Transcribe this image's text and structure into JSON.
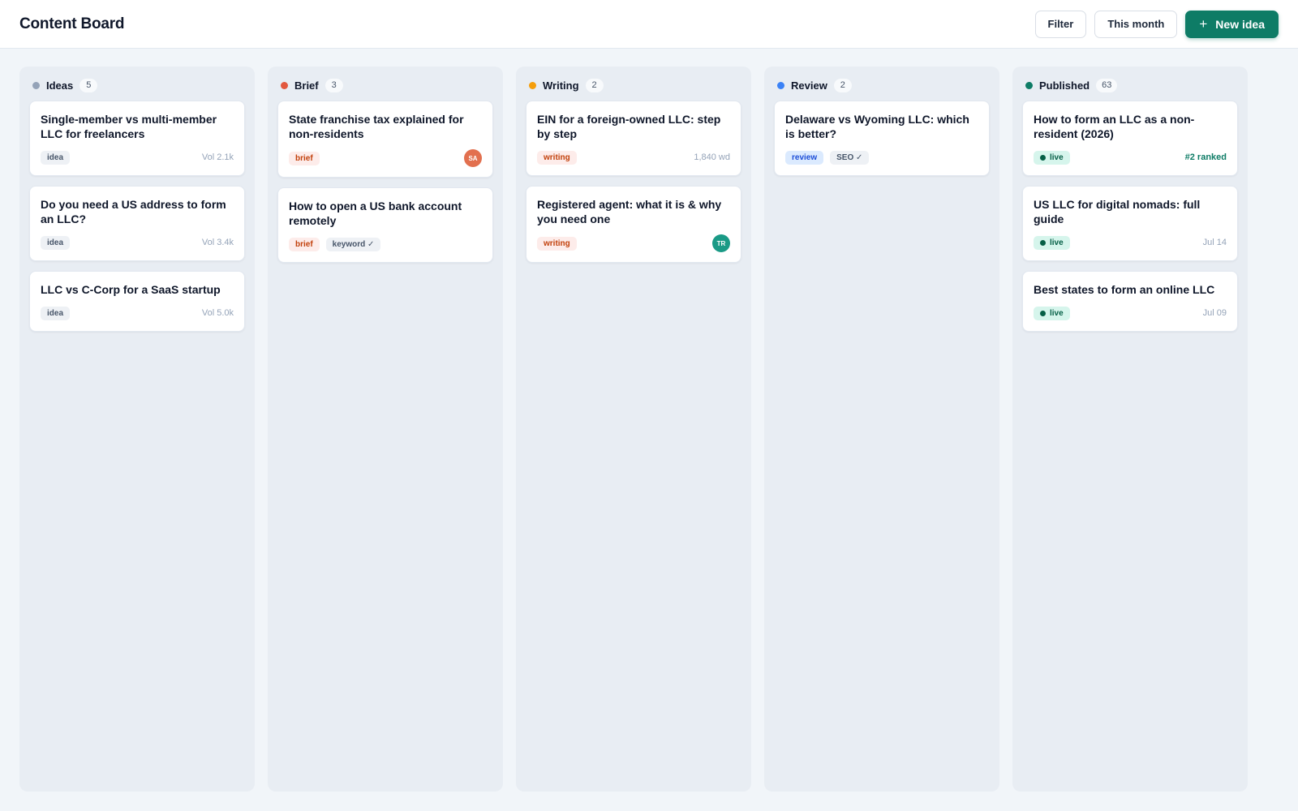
{
  "header": {
    "title": "Content Board",
    "filter_label": "Filter",
    "period_label": "This month",
    "new_label": "New idea",
    "new_icon": "plus-icon"
  },
  "colors": {
    "accent": "#0e7c66",
    "ideas": "#94a3b8",
    "brief": "#e2583e",
    "writing": "#f59e0b",
    "review": "#3b82f6",
    "published": "#0e7c66",
    "avatar_sa": "#e2704f",
    "avatar_tr": "#1a9a86"
  },
  "columns": [
    {
      "key": "ideas",
      "title": "Ideas",
      "count": "5",
      "cards": [
        {
          "title": "Single-member vs multi-member LLC for freelancers",
          "tag": "idea",
          "meta": "Vol 2.1k"
        },
        {
          "title": "Do you need a US address to form an LLC?",
          "tag": "idea",
          "meta": "Vol 3.4k"
        },
        {
          "title": "LLC vs C-Corp for a SaaS startup",
          "tag": "idea",
          "meta": "Vol 5.0k"
        }
      ]
    },
    {
      "key": "brief",
      "title": "Brief",
      "count": "3",
      "cards": [
        {
          "title": "State franchise tax explained for non-residents",
          "tag": "brief",
          "avatar": "SA"
        },
        {
          "title": "How to open a US bank account remotely",
          "tag": "brief",
          "extra_tag": "keyword ✓"
        }
      ]
    },
    {
      "key": "writing",
      "title": "Writing",
      "count": "2",
      "cards": [
        {
          "title": "EIN for a foreign-owned LLC: step by step",
          "tag": "writing",
          "meta": "1,840 wd"
        },
        {
          "title": "Registered agent: what it is & why you need one",
          "tag": "writing",
          "avatar": "TR"
        }
      ]
    },
    {
      "key": "review",
      "title": "Review",
      "count": "2",
      "cards": [
        {
          "title": "Delaware vs Wyoming LLC: which is better?",
          "tag": "review",
          "extra_tag": "SEO ✓"
        }
      ]
    },
    {
      "key": "published",
      "title": "Published",
      "count": "63",
      "cards": [
        {
          "title": "How to form an LLC as a non-resident (2026)",
          "tag": "live",
          "rank": "#2 ranked"
        },
        {
          "title": "US LLC for digital nomads: full guide",
          "tag": "live",
          "meta": "Jul 14"
        },
        {
          "title": "Best states to form an online LLC",
          "tag": "live",
          "meta": "Jul 09"
        }
      ]
    }
  ]
}
